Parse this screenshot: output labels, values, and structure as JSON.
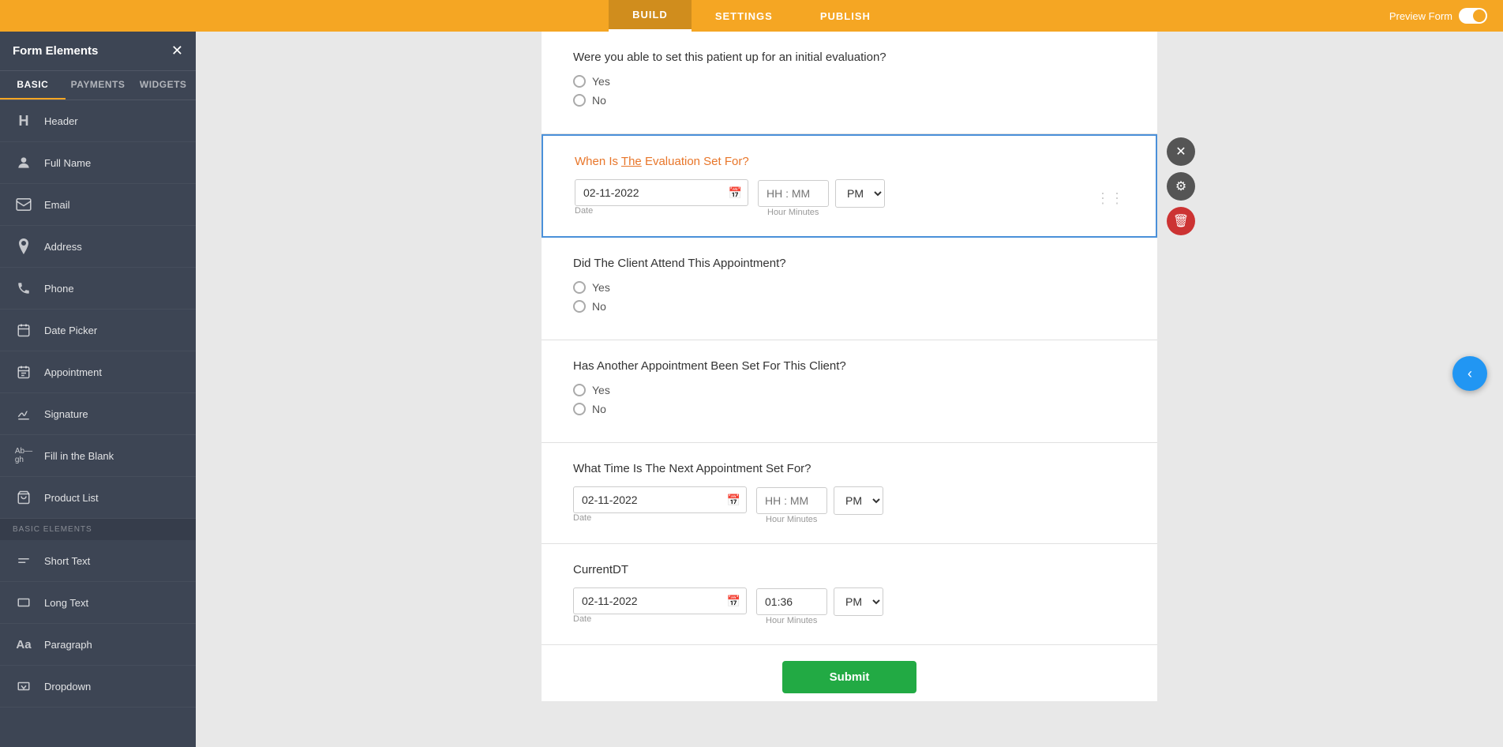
{
  "topNav": {
    "tabs": [
      {
        "id": "build",
        "label": "BUILD",
        "active": true
      },
      {
        "id": "settings",
        "label": "SETTINGS",
        "active": false
      },
      {
        "id": "publish",
        "label": "PUBLISH",
        "active": false
      }
    ],
    "previewLabel": "Preview Form"
  },
  "sidebar": {
    "title": "Form Elements",
    "tabs": [
      {
        "id": "basic",
        "label": "BASIC",
        "active": true
      },
      {
        "id": "payments",
        "label": "PAYMENTS",
        "active": false
      },
      {
        "id": "widgets",
        "label": "WIDGETS",
        "active": false
      }
    ],
    "items": [
      {
        "id": "header",
        "label": "Header",
        "icon": "H"
      },
      {
        "id": "fullname",
        "label": "Full Name",
        "icon": "👤"
      },
      {
        "id": "email",
        "label": "Email",
        "icon": "✉"
      },
      {
        "id": "address",
        "label": "Address",
        "icon": "📍"
      },
      {
        "id": "phone",
        "label": "Phone",
        "icon": "📞"
      },
      {
        "id": "datepicker",
        "label": "Date Picker",
        "icon": "📅"
      },
      {
        "id": "appointment",
        "label": "Appointment",
        "icon": "📆"
      },
      {
        "id": "signature",
        "label": "Signature",
        "icon": "✏"
      },
      {
        "id": "fillinblank",
        "label": "Fill in the Blank",
        "icon": "Ab—gh"
      },
      {
        "id": "productlist",
        "label": "Product List",
        "icon": "🛒"
      }
    ],
    "sectionLabel": "BASIC ELEMENTS",
    "basicItems": [
      {
        "id": "shorttext",
        "label": "Short Text",
        "icon": "≡"
      },
      {
        "id": "longtext",
        "label": "Long Text",
        "icon": "▬"
      },
      {
        "id": "paragraph",
        "label": "Paragraph",
        "icon": "Aa"
      },
      {
        "id": "dropdown",
        "label": "Dropdown",
        "icon": "▼"
      }
    ]
  },
  "form": {
    "sections": [
      {
        "id": "initial-eval",
        "question": "Were you able to set this patient up for an initial evaluation?",
        "type": "radio",
        "options": [
          "Yes",
          "No"
        ]
      },
      {
        "id": "evaluation-date",
        "question": "When Is The Evaluation Set For?",
        "type": "datetime",
        "selected": true,
        "dateValue": "02-11-2022",
        "timeValue": "",
        "timePlaceholder": "HH : MM",
        "ampm": "PM",
        "dateLabelText": "Date",
        "timeLabelText": "Hour Minutes"
      },
      {
        "id": "client-attend",
        "question": "Did The Client Attend This Appointment?",
        "type": "radio",
        "options": [
          "Yes",
          "No"
        ]
      },
      {
        "id": "another-appointment",
        "question": "Has Another Appointment Been Set For This Client?",
        "type": "radio",
        "options": [
          "Yes",
          "No"
        ]
      },
      {
        "id": "next-appointment-time",
        "question": "What Time Is The Next Appointment Set For?",
        "type": "datetime",
        "dateValue": "02-11-2022",
        "timeValue": "",
        "timePlaceholder": "HH : MM",
        "ampm": "PM",
        "dateLabelText": "Date",
        "timeLabelText": "Hour Minutes"
      },
      {
        "id": "currentdt",
        "question": "CurrentDT",
        "type": "datetime",
        "dateValue": "02-11-2022",
        "timeValue": "01:36",
        "timePlaceholder": "HH : MM",
        "ampm": "PM",
        "dateLabelText": "Date",
        "timeLabelText": "Hour Minutes"
      }
    ],
    "submitLabel": "Submit"
  },
  "cardActions": {
    "closeIcon": "✕",
    "gearIcon": "⚙",
    "deleteIcon": "🗑"
  },
  "floatBack": {
    "icon": "‹"
  }
}
